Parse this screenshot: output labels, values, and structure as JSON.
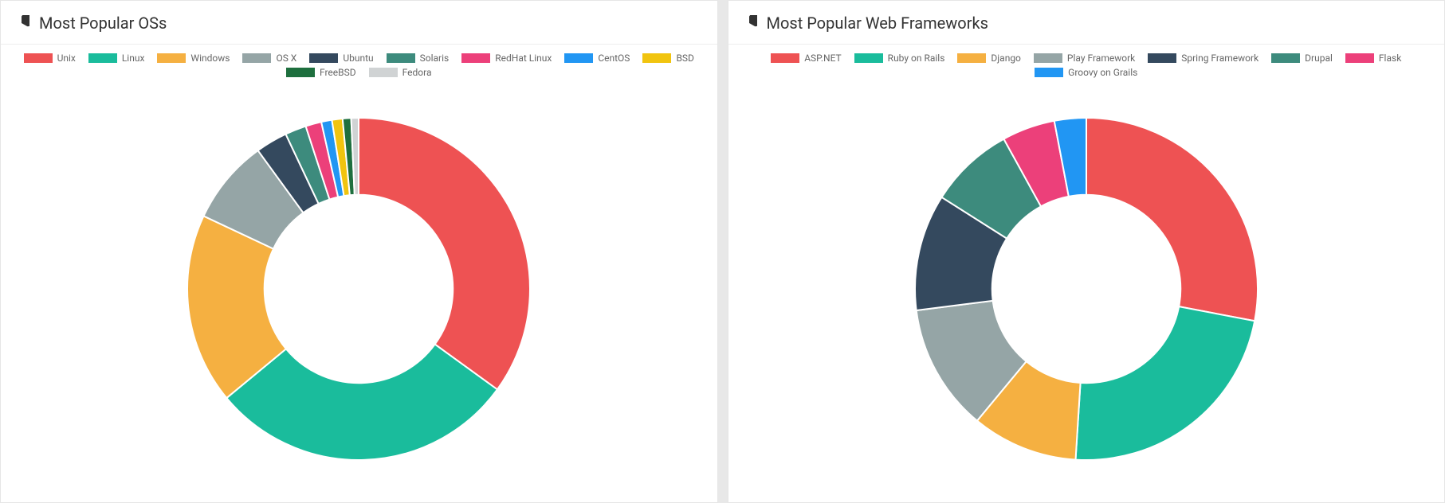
{
  "cards": {
    "os": {
      "title": "Most Popular OSs"
    },
    "web": {
      "title": "Most Popular Web Frameworks"
    }
  },
  "colors": {
    "red": "#ee5253",
    "teal": "#1abc9c",
    "orange": "#f5b041",
    "grayblue": "#95a5a6",
    "darkslate": "#34495e",
    "seagreen": "#3d8b7d",
    "pink": "#ec407a",
    "blue": "#2196f3",
    "amber": "#f1c40f",
    "darkgreen": "#1e6f3e",
    "lightgray": "#d0d3d4"
  },
  "chart_data": [
    {
      "id": "os",
      "type": "pie",
      "title": "Most Popular OSs",
      "series": [
        {
          "name": "Unix",
          "value": 35,
          "colorKey": "red"
        },
        {
          "name": "Linux",
          "value": 29,
          "colorKey": "teal"
        },
        {
          "name": "Windows",
          "value": 18,
          "colorKey": "orange"
        },
        {
          "name": "OS X",
          "value": 8,
          "colorKey": "grayblue"
        },
        {
          "name": "Ubuntu",
          "value": 3,
          "colorKey": "darkslate"
        },
        {
          "name": "Solaris",
          "value": 2,
          "colorKey": "seagreen"
        },
        {
          "name": "RedHat Linux",
          "value": 1.5,
          "colorKey": "pink"
        },
        {
          "name": "CentOS",
          "value": 1,
          "colorKey": "blue"
        },
        {
          "name": "BSD",
          "value": 1,
          "colorKey": "amber"
        },
        {
          "name": "FreeBSD",
          "value": 0.8,
          "colorKey": "darkgreen"
        },
        {
          "name": "Fedora",
          "value": 0.7,
          "colorKey": "lightgray"
        }
      ],
      "inner_radius_ratio": 0.55,
      "start_angle_deg": -90
    },
    {
      "id": "web",
      "type": "pie",
      "title": "Most Popular Web Frameworks",
      "series": [
        {
          "name": "ASP.NET",
          "value": 28,
          "colorKey": "red"
        },
        {
          "name": "Ruby on Rails",
          "value": 23,
          "colorKey": "teal"
        },
        {
          "name": "Django",
          "value": 10,
          "colorKey": "orange"
        },
        {
          "name": "Play Framework",
          "value": 12,
          "colorKey": "grayblue"
        },
        {
          "name": "Spring Framework",
          "value": 11,
          "colorKey": "darkslate"
        },
        {
          "name": "Drupal",
          "value": 8,
          "colorKey": "seagreen"
        },
        {
          "name": "Flask",
          "value": 5,
          "colorKey": "pink"
        },
        {
          "name": "Groovy on Grails",
          "value": 3,
          "colorKey": "blue"
        }
      ],
      "inner_radius_ratio": 0.55,
      "start_angle_deg": -90
    }
  ]
}
